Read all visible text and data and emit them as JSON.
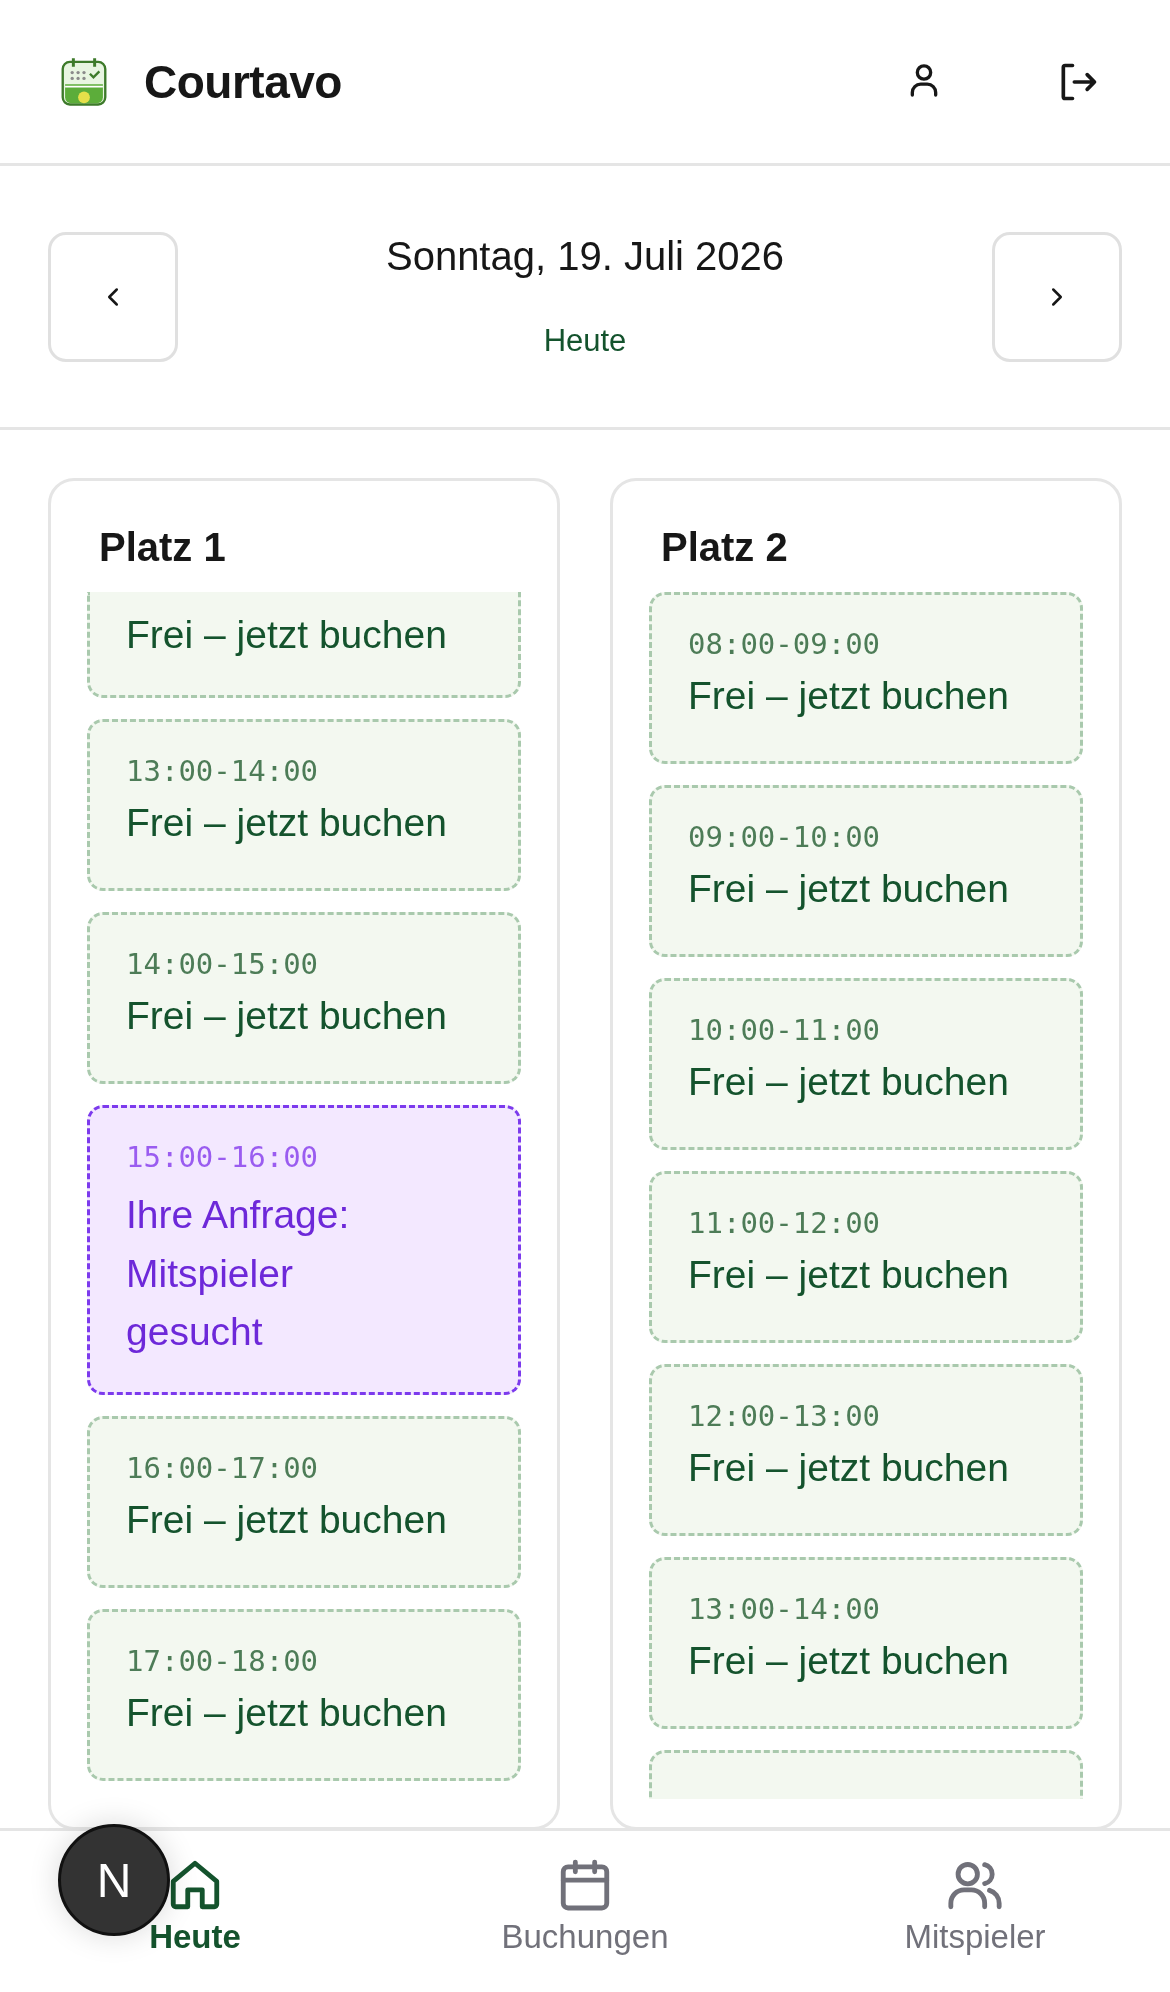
{
  "header": {
    "app_name": "Courtavo"
  },
  "date_nav": {
    "date": "Sonntag, 19. Juli 2026",
    "today_label": "Heute"
  },
  "courts": [
    {
      "name": "Platz 1",
      "slots": [
        {
          "kind": "free",
          "status": "Frei – jetzt buchen",
          "cut": true
        },
        {
          "kind": "free",
          "time": "13:00-14:00",
          "status": "Frei – jetzt buchen"
        },
        {
          "kind": "free",
          "time": "14:00-15:00",
          "status": "Frei – jetzt buchen"
        },
        {
          "kind": "request",
          "time": "15:00-16:00",
          "status": "Ihre Anfrage: Mitspieler gesucht"
        },
        {
          "kind": "free",
          "time": "16:00-17:00",
          "status": "Frei – jetzt buchen"
        },
        {
          "kind": "free",
          "time": "17:00-18:00",
          "status": "Frei – jetzt buchen"
        }
      ]
    },
    {
      "name": "Platz 2",
      "slots": [
        {
          "kind": "free",
          "time": "08:00-09:00",
          "status": "Frei – jetzt buchen"
        },
        {
          "kind": "free",
          "time": "09:00-10:00",
          "status": "Frei – jetzt buchen"
        },
        {
          "kind": "free",
          "time": "10:00-11:00",
          "status": "Frei – jetzt buchen"
        },
        {
          "kind": "free",
          "time": "11:00-12:00",
          "status": "Frei – jetzt buchen"
        },
        {
          "kind": "free",
          "time": "12:00-13:00",
          "status": "Frei – jetzt buchen"
        },
        {
          "kind": "free",
          "time": "13:00-14:00",
          "status": "Frei – jetzt buchen"
        },
        {
          "kind": "free"
        }
      ]
    }
  ],
  "bottom_nav": [
    {
      "label": "Heute",
      "kind": "home",
      "selected": true
    },
    {
      "label": "Buchungen",
      "kind": "calendar",
      "selected": false
    },
    {
      "label": "Mitspieler",
      "kind": "users",
      "selected": false
    }
  ],
  "dev_badge": {
    "label": "N"
  }
}
